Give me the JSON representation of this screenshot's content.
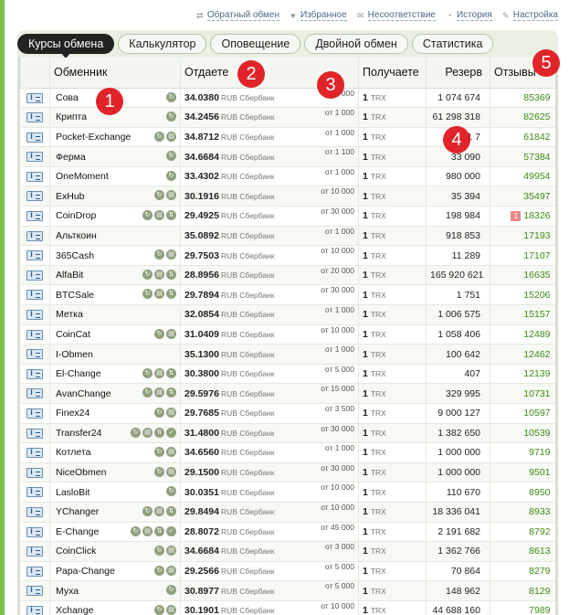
{
  "toplinks": [
    {
      "label": "Обратный обмен",
      "icon": "swap-icon"
    },
    {
      "label": "Избранное",
      "icon": "heart-icon"
    },
    {
      "label": "Несоответствие",
      "icon": "mail-icon"
    },
    {
      "label": "История",
      "icon": "history-icon"
    },
    {
      "label": "Настройка",
      "icon": "wrench-icon"
    }
  ],
  "tabs": [
    {
      "label": "Курсы обмена",
      "active": true
    },
    {
      "label": "Калькулятор"
    },
    {
      "label": "Оповещение"
    },
    {
      "label": "Двойной обмен"
    },
    {
      "label": "Статистика"
    }
  ],
  "headers": {
    "exchanger": "Обменник",
    "give": "Отдаете",
    "get": "Получаете",
    "reserve": "Резерв",
    "reviews": "Отзывы"
  },
  "markers": [
    "1",
    "2",
    "3",
    "4",
    "5"
  ],
  "give_currency": "RUB Сбербанк",
  "get_amount": "1",
  "get_currency": "TRX",
  "rows": [
    {
      "name": "Сова",
      "rate": "34.0380",
      "min": "от 1 000",
      "reserve": "1 074 674",
      "reviews": "85369",
      "icons": 1
    },
    {
      "name": "Крипта",
      "rate": "34.2456",
      "min": "от 1 000",
      "reserve": "61 298 318",
      "reviews": "82625",
      "icons": 1
    },
    {
      "name": "Pocket-Exchange",
      "rate": "34.8712",
      "min": "от 1 000",
      "reserve": "1 1 7",
      "reviews": "61842",
      "icons": 2
    },
    {
      "name": "Ферма",
      "rate": "34.6684",
      "min": "от 1 100",
      "reserve": "33 090",
      "reviews": "57384",
      "icons": 1
    },
    {
      "name": "OneMoment",
      "rate": "33.4302",
      "min": "от 1 000",
      "reserve": "980 000",
      "reviews": "49954",
      "icons": 1
    },
    {
      "name": "ExHub",
      "rate": "30.1916",
      "min": "от 10 000",
      "reserve": "35 394",
      "reviews": "35497",
      "icons": 2
    },
    {
      "name": "CoinDrop",
      "rate": "29.4925",
      "min": "от 30 000",
      "reserve": "198 984",
      "reviews": "18326",
      "icons": 3,
      "badge": "1"
    },
    {
      "name": "Альткоин",
      "rate": "35.0892",
      "min": "от 1 000",
      "reserve": "918 853",
      "reviews": "17193",
      "icons": 0
    },
    {
      "name": "365Cash",
      "rate": "29.7503",
      "min": "от 10 000",
      "reserve": "11 289",
      "reviews": "17107",
      "icons": 2
    },
    {
      "name": "AlfaBit",
      "rate": "28.8956",
      "min": "от 20 000",
      "reserve": "165 920 621",
      "reviews": "16635",
      "icons": 3
    },
    {
      "name": "BTCSale",
      "rate": "29.7894",
      "min": "от 30 000",
      "reserve": "1 751",
      "reviews": "15206",
      "icons": 3
    },
    {
      "name": "Метка",
      "rate": "32.0854",
      "min": "от 1 000",
      "reserve": "1 006 575",
      "reviews": "15157",
      "icons": 0
    },
    {
      "name": "CoinCat",
      "rate": "31.0409",
      "min": "от 10 000",
      "reserve": "1 058 406",
      "reviews": "12489",
      "icons": 2
    },
    {
      "name": "I-Obmen",
      "rate": "35.1300",
      "min": "от 1 000",
      "reserve": "100 642",
      "reviews": "12462",
      "icons": 0
    },
    {
      "name": "El-Change",
      "rate": "30.3800",
      "min": "от 5 000",
      "reserve": "407",
      "reviews": "12139",
      "icons": 3
    },
    {
      "name": "AvanChange",
      "rate": "29.5976",
      "min": "от 15 000",
      "reserve": "329 995",
      "reviews": "10731",
      "icons": 3
    },
    {
      "name": "Finex24",
      "rate": "29.7685",
      "min": "от 3 500",
      "reserve": "9 000 127",
      "reviews": "10597",
      "icons": 2
    },
    {
      "name": "Transfer24",
      "rate": "31.4800",
      "min": "от 30 000",
      "reserve": "1 382 650",
      "reviews": "10539",
      "icons": 4
    },
    {
      "name": "Котлета",
      "rate": "34.6560",
      "min": "от 1 000",
      "reserve": "1 000 000",
      "reviews": "9719",
      "icons": 2
    },
    {
      "name": "NiceObmen",
      "rate": "29.1500",
      "min": "от 30 000",
      "reserve": "1 000 000",
      "reviews": "9501",
      "icons": 2
    },
    {
      "name": "LasloBit",
      "rate": "30.0351",
      "min": "от 10 000",
      "reserve": "110 670",
      "reviews": "8950",
      "icons": 1
    },
    {
      "name": "YChanger",
      "rate": "29.8494",
      "min": "от 10 000",
      "reserve": "18 336 041",
      "reviews": "8933",
      "icons": 3
    },
    {
      "name": "E-Change",
      "rate": "28.8072",
      "min": "от 45 000",
      "reserve": "2 191 682",
      "reviews": "8792",
      "icons": 4
    },
    {
      "name": "CoinClick",
      "rate": "34.6684",
      "min": "от 3 000",
      "reserve": "1 362 766",
      "reviews": "8613",
      "icons": 2
    },
    {
      "name": "Papa-Change",
      "rate": "29.2566",
      "min": "от 5 000",
      "reserve": "70 864",
      "reviews": "8279",
      "icons": 2
    },
    {
      "name": "Муха",
      "rate": "30.8977",
      "min": "от 5 000",
      "reserve": "148 962",
      "reviews": "8129",
      "icons": 1
    },
    {
      "name": "Xchange",
      "rate": "30.1901",
      "min": "от 10 000",
      "reserve": "44 688 160",
      "reviews": "7989",
      "icons": 2
    }
  ]
}
